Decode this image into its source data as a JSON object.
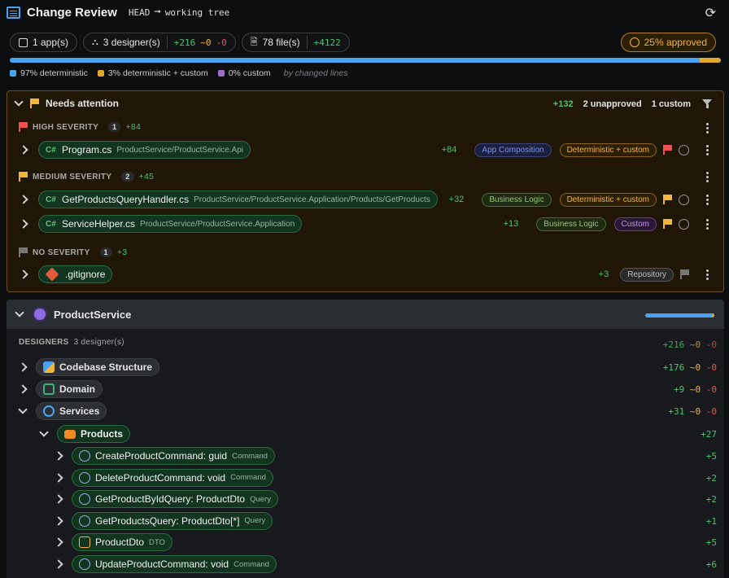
{
  "header": {
    "title": "Change Review",
    "ref_from": "HEAD",
    "ref_to": "working tree"
  },
  "summary": {
    "apps": "1 app(s)",
    "designers": "3 designer(s)",
    "designers_add": "+216",
    "designers_mod": "~0",
    "designers_del": "-0",
    "files": "78 file(s)",
    "files_add": "+4122",
    "approved": "25% approved"
  },
  "progress": {
    "deterministic_pct": 97,
    "det_custom_pct": 3,
    "custom_pct": 0
  },
  "legend": {
    "deterministic": "97% deterministic",
    "det_custom": "3% deterministic + custom",
    "custom": "0% custom",
    "note": "by changed lines"
  },
  "attention": {
    "title": "Needs attention",
    "added": "+132",
    "unapproved": "2 unapproved",
    "custom": "1 custom",
    "groups": [
      {
        "label": "HIGH SEVERITY",
        "count": "1",
        "added": "+84"
      },
      {
        "label": "MEDIUM SEVERITY",
        "count": "2",
        "added": "+45"
      },
      {
        "label": "NO SEVERITY",
        "count": "1",
        "added": "+3"
      }
    ],
    "files": [
      {
        "name": "Program.cs",
        "path": "ProductService/ProductService.Api",
        "added": "+84",
        "tag1": "App Composition",
        "tag2": "Deterministic + custom"
      },
      {
        "name": "GetProductsQueryHandler.cs",
        "path": "ProductService/ProductService.Application/Products/GetProducts",
        "added": "+32",
        "tag1": "Business Logic",
        "tag2": "Deterministic + custom"
      },
      {
        "name": "ServiceHelper.cs",
        "path": "ProductService/ProductService.Application",
        "added": "+13",
        "tag1": "Business Logic",
        "tag2": "Custom"
      },
      {
        "name": ".gitignore",
        "path": "",
        "added": "+3",
        "tag1": "Repository",
        "tag2": ""
      }
    ]
  },
  "service": {
    "name": "ProductService",
    "designers_label": "DESIGNERS",
    "designers_count": "3 designer(s)",
    "designers_stats": {
      "add": "+216",
      "mod": "~0",
      "del": "-0"
    },
    "designers": [
      {
        "name": "Codebase Structure",
        "add": "+176",
        "mod": "~0",
        "del": "-0"
      },
      {
        "name": "Domain",
        "add": "+9",
        "mod": "~0",
        "del": "-0"
      },
      {
        "name": "Services",
        "add": "+31",
        "mod": "~0",
        "del": "-0"
      }
    ],
    "folder": {
      "name": "Products",
      "add": "+27"
    },
    "items": [
      {
        "name": "CreateProductCommand: guid",
        "kind": "Command",
        "add": "+5"
      },
      {
        "name": "DeleteProductCommand: void",
        "kind": "Command",
        "add": "+2"
      },
      {
        "name": "GetProductByIdQuery: ProductDto",
        "kind": "Query",
        "add": "+2"
      },
      {
        "name": "GetProductsQuery: ProductDto[*]",
        "kind": "Query",
        "add": "+1"
      },
      {
        "name": "ProductDto",
        "kind": "DTO",
        "add": "+5"
      },
      {
        "name": "UpdateProductCommand: void",
        "kind": "Command",
        "add": "+6"
      }
    ]
  },
  "colors": {
    "accent": "#4aa3f0",
    "warn": "#f0b53b",
    "add": "#4ec36b",
    "del": "#f05050"
  }
}
